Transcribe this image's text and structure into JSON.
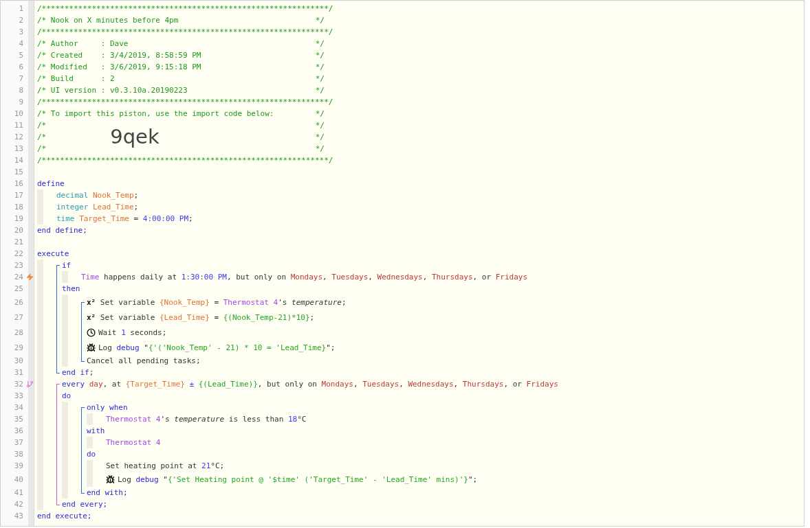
{
  "editor": {
    "lines": [
      {
        "kind": "comment",
        "number": "1",
        "text": "/***************************************************************/"
      },
      {
        "kind": "comment",
        "number": "2",
        "text": "/* Nook on X minutes before 4pm",
        "end": "*/"
      },
      {
        "kind": "comment",
        "number": "3",
        "text": "/***************************************************************/"
      },
      {
        "kind": "comment",
        "number": "4",
        "text": "/* Author     : Dave",
        "end": "*/"
      },
      {
        "kind": "comment",
        "number": "5",
        "text": "/* Created    : 3/4/2019, 8:58:59 PM",
        "end": "*/"
      },
      {
        "kind": "comment",
        "number": "6",
        "text": "/* Modified   : 3/6/2019, 9:15:18 PM",
        "end": "*/"
      },
      {
        "kind": "comment",
        "number": "7",
        "text": "/* Build      : 2",
        "end": "*/"
      },
      {
        "kind": "comment",
        "number": "8",
        "text": "/* UI version : v0.3.10a.20190223",
        "end": "*/"
      },
      {
        "kind": "comment",
        "number": "9",
        "text": "/***************************************************************/"
      },
      {
        "kind": "comment",
        "number": "10",
        "text": "/* To import this piston, use the import code below:",
        "end": "*/"
      },
      {
        "kind": "comment",
        "number": "11",
        "text": "/*",
        "end": "*/"
      },
      {
        "kind": "comment",
        "number": "12",
        "text": "/*",
        "code": "9qek",
        "end": "*/"
      },
      {
        "kind": "comment",
        "number": "13",
        "text": "/*",
        "end": "*/"
      },
      {
        "kind": "comment",
        "number": "14",
        "text": "/***************************************************************/"
      },
      {
        "kind": "code",
        "number": "15"
      },
      {
        "kind": "code",
        "number": "16",
        "tokens": [
          {
            "text": "define",
            "kind": "keyword"
          }
        ],
        "children": [
          {
            "kind": "code",
            "number": "17",
            "tokens": [
              {
                "text": "decimal ",
                "kind": "type"
              },
              {
                "text": "Nook_Temp",
                "kind": "variable"
              },
              {
                "text": ";",
                "kind": "plain"
              }
            ]
          },
          {
            "kind": "code",
            "number": "18",
            "tokens": [
              {
                "text": "integer ",
                "kind": "type"
              },
              {
                "text": "Lead_Time",
                "kind": "variable"
              },
              {
                "text": ";",
                "kind": "plain"
              }
            ]
          },
          {
            "kind": "code",
            "number": "19",
            "tokens": [
              {
                "text": "time ",
                "kind": "type"
              },
              {
                "text": "Target_Time",
                "kind": "variable"
              },
              {
                "text": " = ",
                "kind": "plain"
              },
              {
                "text": "4:00:00 PM",
                "kind": "value"
              },
              {
                "text": ";",
                "kind": "plain"
              }
            ]
          }
        ]
      },
      {
        "kind": "code",
        "number": "20",
        "tokens": [
          {
            "text": "end define;",
            "kind": "keyword"
          }
        ]
      },
      {
        "kind": "code",
        "number": "21"
      },
      {
        "kind": "code",
        "number": "22",
        "tokens": [
          {
            "text": "execute",
            "kind": "keyword"
          }
        ],
        "children": [
          {
            "kind": "block",
            "items": [
              {
                "kind": "code",
                "number": "23",
                "tokens": [
                  {
                    "text": "if",
                    "kind": "keyword"
                  }
                ],
                "children": [
                  {
                    "kind": "trigger",
                    "number": "24",
                    "tokens": [
                      {
                        "text": "Time",
                        "kind": "device"
                      },
                      {
                        "text": " happens daily at ",
                        "kind": "plain"
                      },
                      {
                        "text": "1:30:00 PM",
                        "kind": "value"
                      },
                      {
                        "text": ", but only on ",
                        "kind": "plain"
                      },
                      {
                        "text": "Mondays",
                        "kind": "day"
                      },
                      {
                        "text": ", ",
                        "kind": "plain"
                      },
                      {
                        "text": "Tuesdays",
                        "kind": "day"
                      },
                      {
                        "text": ", ",
                        "kind": "plain"
                      },
                      {
                        "text": "Wednesdays",
                        "kind": "day"
                      },
                      {
                        "text": ", ",
                        "kind": "plain"
                      },
                      {
                        "text": "Thursdays",
                        "kind": "day"
                      },
                      {
                        "text": ", or ",
                        "kind": "plain"
                      },
                      {
                        "text": "Fridays",
                        "kind": "day"
                      }
                    ]
                  }
                ]
              },
              {
                "kind": "code",
                "number": "25",
                "tokens": [
                  {
                    "text": "then",
                    "kind": "keyword"
                  }
                ],
                "children": [
                  {
                    "kind": "block",
                    "items": [
                      {
                        "kind": "code",
                        "number": "26",
                        "tokens": [
                          {
                            "text": "x²",
                            "kind": "glyph"
                          },
                          {
                            "text": " Set variable ",
                            "kind": "plain"
                          },
                          {
                            "text": "{Nook_Temp}",
                            "kind": "variable"
                          },
                          {
                            "text": " = ",
                            "kind": "plain"
                          },
                          {
                            "text": "Thermostat 4",
                            "kind": "device"
                          },
                          {
                            "text": "'s ",
                            "kind": "plain"
                          },
                          {
                            "text": "temperature",
                            "kind": "attribute"
                          },
                          {
                            "text": ";",
                            "kind": "plain"
                          }
                        ]
                      },
                      {
                        "kind": "code",
                        "number": "27",
                        "tokens": [
                          {
                            "text": "x²",
                            "kind": "glyph"
                          },
                          {
                            "text": " Set variable ",
                            "kind": "plain"
                          },
                          {
                            "text": "{Lead_Time}",
                            "kind": "variable"
                          },
                          {
                            "text": " = ",
                            "kind": "plain"
                          },
                          {
                            "text": "{(Nook_Temp-21)*10}",
                            "kind": "expression"
                          },
                          {
                            "text": ";",
                            "kind": "plain"
                          }
                        ]
                      },
                      {
                        "kind": "wait",
                        "number": "28",
                        "tokens": [
                          {
                            "text": "Wait ",
                            "kind": "plain"
                          },
                          {
                            "text": "1",
                            "kind": "value"
                          },
                          {
                            "text": " seconds;",
                            "kind": "plain"
                          }
                        ]
                      },
                      {
                        "kind": "log",
                        "number": "29",
                        "tokens": [
                          {
                            "text": "Log ",
                            "kind": "plain"
                          },
                          {
                            "text": "debug",
                            "kind": "keyword"
                          },
                          {
                            "text": " \"",
                            "kind": "plain"
                          },
                          {
                            "text": "{'('Nook_Temp' - 21) * 10 = 'Lead_Time}",
                            "kind": "expression"
                          },
                          {
                            "text": "\";",
                            "kind": "plain"
                          }
                        ]
                      },
                      {
                        "kind": "code",
                        "number": "30",
                        "tokens": [
                          {
                            "text": "Cancel all pending tasks;",
                            "kind": "plain"
                          }
                        ]
                      }
                    ]
                  }
                ]
              },
              {
                "kind": "code",
                "number": "31",
                "tokens": [
                  {
                    "text": "end if;",
                    "kind": "keyword"
                  }
                ]
              }
            ]
          },
          {
            "kind": "every",
            "items": [
              {
                "kind": "timer",
                "number": "32",
                "tokens": [
                  {
                    "text": "every ",
                    "kind": "keyword"
                  },
                  {
                    "text": "day",
                    "kind": "day"
                  },
                  {
                    "text": ", at ",
                    "kind": "plain"
                  },
                  {
                    "text": "{Target_Time}",
                    "kind": "variable"
                  },
                  {
                    "text": " ± ",
                    "kind": "value"
                  },
                  {
                    "text": "{(Lead_Time)}",
                    "kind": "expression"
                  },
                  {
                    "text": ", but only on ",
                    "kind": "plain"
                  },
                  {
                    "text": "Mondays",
                    "kind": "day"
                  },
                  {
                    "text": ", ",
                    "kind": "plain"
                  },
                  {
                    "text": "Tuesdays",
                    "kind": "day"
                  },
                  {
                    "text": ", ",
                    "kind": "plain"
                  },
                  {
                    "text": "Wednesdays",
                    "kind": "day"
                  },
                  {
                    "text": ", ",
                    "kind": "plain"
                  },
                  {
                    "text": "Thursdays",
                    "kind": "day"
                  },
                  {
                    "text": ", or ",
                    "kind": "plain"
                  },
                  {
                    "text": "Fridays",
                    "kind": "day"
                  }
                ]
              },
              {
                "kind": "code",
                "number": "33",
                "tokens": [
                  {
                    "text": "do",
                    "kind": "keyword"
                  }
                ],
                "children": [
                  {
                    "kind": "block",
                    "items": [
                      {
                        "kind": "code",
                        "number": "34",
                        "tokens": [
                          {
                            "text": "only when",
                            "kind": "keyword"
                          }
                        ],
                        "children": [
                          {
                            "kind": "code",
                            "number": "35",
                            "tokens": [
                              {
                                "text": "Thermostat 4",
                                "kind": "device"
                              },
                              {
                                "text": "'s ",
                                "kind": "plain"
                              },
                              {
                                "text": "temperature",
                                "kind": "attribute"
                              },
                              {
                                "text": " is less than ",
                                "kind": "plain"
                              },
                              {
                                "text": "18",
                                "kind": "value"
                              },
                              {
                                "text": "°C",
                                "kind": "plain"
                              }
                            ]
                          }
                        ]
                      },
                      {
                        "kind": "code",
                        "number": "36",
                        "tokens": [
                          {
                            "text": "with",
                            "kind": "keyword"
                          }
                        ],
                        "children": [
                          {
                            "kind": "code",
                            "number": "37",
                            "tokens": [
                              {
                                "text": "Thermostat 4",
                                "kind": "device"
                              }
                            ]
                          }
                        ]
                      },
                      {
                        "kind": "code",
                        "number": "38",
                        "tokens": [
                          {
                            "text": "do",
                            "kind": "keyword"
                          }
                        ],
                        "children": [
                          {
                            "kind": "code",
                            "number": "39",
                            "tokens": [
                              {
                                "text": "Set heating point at ",
                                "kind": "plain"
                              },
                              {
                                "text": "21",
                                "kind": "value"
                              },
                              {
                                "text": "°C;",
                                "kind": "plain"
                              }
                            ]
                          },
                          {
                            "kind": "log",
                            "number": "40",
                            "tokens": [
                              {
                                "text": "Log ",
                                "kind": "plain"
                              },
                              {
                                "text": "debug",
                                "kind": "keyword"
                              },
                              {
                                "text": " \"",
                                "kind": "plain"
                              },
                              {
                                "text": "{'Set Heating point @ '$time' ('Target_Time' - 'Lead_Time' mins)'}",
                                "kind": "expression"
                              },
                              {
                                "text": "\";",
                                "kind": "plain"
                              }
                            ]
                          }
                        ]
                      },
                      {
                        "kind": "code",
                        "number": "41",
                        "tokens": [
                          {
                            "text": "end with;",
                            "kind": "keyword"
                          }
                        ]
                      }
                    ]
                  }
                ]
              },
              {
                "kind": "code",
                "number": "42",
                "tokens": [
                  {
                    "text": "end every;",
                    "kind": "keyword"
                  }
                ]
              }
            ]
          }
        ]
      },
      {
        "kind": "code",
        "number": "43",
        "tokens": [
          {
            "text": "end execute;",
            "kind": "keyword"
          }
        ]
      }
    ]
  }
}
